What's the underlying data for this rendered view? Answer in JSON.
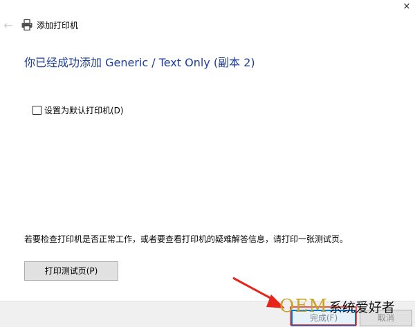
{
  "window": {
    "title": "添加打印机",
    "close_glyph": "×"
  },
  "nav": {
    "back_glyph": "←"
  },
  "main": {
    "heading": "你已经成功添加 Generic / Text Only (副本 2)",
    "default_checkbox": {
      "label": "设置为默认打印机(D)",
      "checked": false
    },
    "info_text": "若要检查打印机是否正常工作，或者要查看打印机的疑难解答信息，请打印一张测试页。",
    "test_page_button": "打印测试页(P)"
  },
  "footer": {
    "finish_button": "完成(F)",
    "cancel_button": "取消"
  },
  "watermark": {
    "brand": "OEM",
    "text": "系统爱好者"
  },
  "colors": {
    "heading": "#1b3d9b",
    "focus_border": "#0078d7",
    "footer_bg": "#f0f0f0",
    "annotation_arrow": "#e8231a",
    "annotation_box": "#e8231a",
    "watermark_gold": "#c9a227"
  },
  "icons": {
    "back": "back-arrow-icon",
    "printer": "printer-icon",
    "close": "close-icon"
  }
}
